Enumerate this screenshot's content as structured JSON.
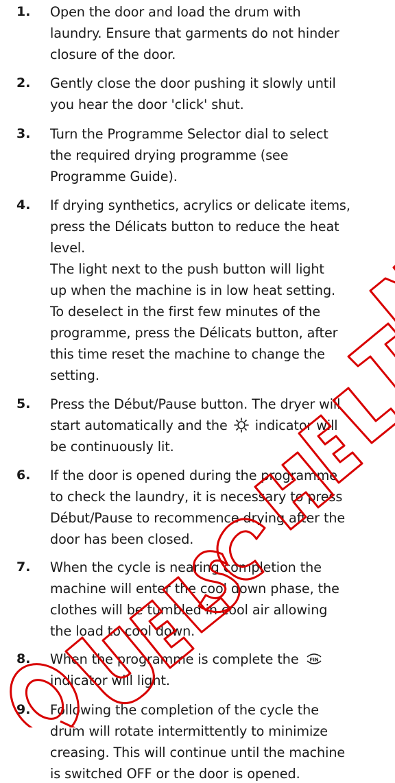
{
  "steps": [
    {
      "number": "1.",
      "lines": [
        "Open the door and load the drum with",
        "laundry. Ensure that garments do not hinder",
        "closure of the door."
      ]
    },
    {
      "number": "2.",
      "lines": [
        "Gently close the door pushing it slowly until",
        "you hear the door 'click' shut."
      ]
    },
    {
      "number": "3.",
      "lines": [
        "Turn the Programme Selector dial to select",
        "the required drying programme (see",
        "Programme Guide)."
      ]
    },
    {
      "number": "4.",
      "lines": [
        "If drying synthetics, acrylics or delicate items,",
        "press the Délicats button to reduce the heat",
        "level.",
        "The light next to the push button will light",
        "up when the machine is in low heat setting.",
        "To deselect in the first few minutes of the",
        "programme, press the Délicats button, after",
        "this time reset the machine to change the",
        "setting."
      ]
    },
    {
      "number": "5.",
      "lines": [
        "Press the Début/Pause button. The dryer will"
      ],
      "line2_before": "start automatically and the",
      "line2_after": "indicator will",
      "line3": "be continuously lit."
    },
    {
      "number": "6.",
      "lines": [
        "If the door is opened during the programme",
        "to check the laundry, it is necessary to press",
        "Début/Pause to recommence drying after the",
        "door has been closed."
      ]
    },
    {
      "number": "7.",
      "lines": [
        "When the cycle is nearing completion the",
        "machine will enter the cool down phase, the",
        "clothes will be tumbled in cool air allowing",
        "the load to cool down."
      ]
    },
    {
      "number": "8.",
      "line1_before": "When the programme is complete the",
      "icon_text": "FIN",
      "line2": "indicator will light."
    },
    {
      "number": "9.",
      "lines": [
        "Following the completion of the cycle the",
        "drum will rotate intermittently to minimize",
        "creasing. This will continue until the machine",
        "is switched OFF or the door is opened."
      ]
    }
  ],
  "icons": {
    "sun": "sun-indicator-icon",
    "fin": "fin-indicator-icon"
  },
  "watermark": {
    "text": "QUELSCHELTN",
    "color": "#d80000"
  }
}
